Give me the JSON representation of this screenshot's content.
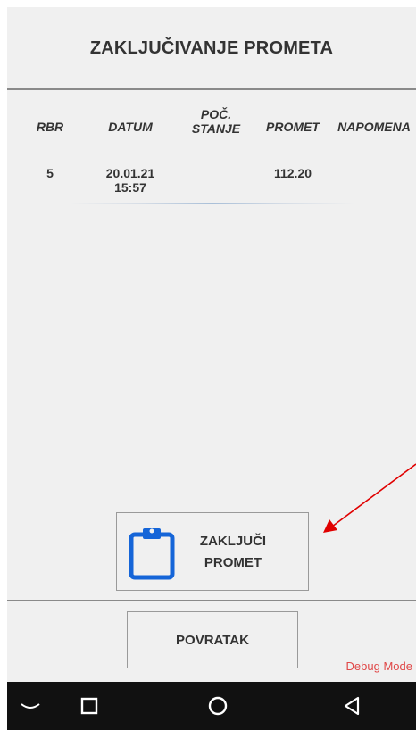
{
  "header": {
    "title": "ZAKLJUČIVANJE PROMETA"
  },
  "table": {
    "columns": [
      {
        "line1": "RBR",
        "line2": ""
      },
      {
        "line1": "DATUM",
        "line2": ""
      },
      {
        "line1": "POČ.",
        "line2": "STANJE"
      },
      {
        "line1": "PROMET",
        "line2": ""
      },
      {
        "line1": "NAPOMENA",
        "line2": ""
      }
    ],
    "rows": [
      {
        "rbr": "5",
        "datum_line1": "20.01.21",
        "datum_line2": "15:57",
        "poc_stanje": "",
        "promet": "112.20",
        "napomena": ""
      }
    ]
  },
  "actions": {
    "close_line1": "ZAKLJUČI",
    "close_line2": "PROMET",
    "close_icon": "clipboard-icon",
    "back_label": "POVRATAK"
  },
  "debug_label": "Debug Mode",
  "navbar": {
    "icons": [
      "collapse-keyboard-icon",
      "recents-icon",
      "home-icon",
      "back-icon"
    ]
  },
  "colors": {
    "icon_blue": "#1565d8",
    "annotation_red": "#e00000",
    "debug_red": "#e04848"
  }
}
